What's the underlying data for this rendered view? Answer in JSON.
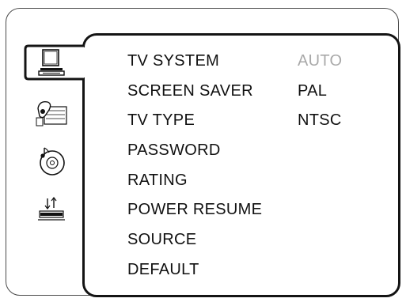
{
  "sidebar": {
    "icons": [
      {
        "name": "tv-monitor-icon",
        "active": true
      },
      {
        "name": "speaker-doc-icon",
        "active": false
      },
      {
        "name": "disc-music-icon",
        "active": false
      },
      {
        "name": "transfer-icon",
        "active": false
      }
    ]
  },
  "menu": {
    "items": [
      {
        "label": "TV  SYSTEM",
        "selected": true
      },
      {
        "label": "SCREEN SAVER",
        "selected": false
      },
      {
        "label": "TV TYPE",
        "selected": false
      },
      {
        "label": "PASSWORD",
        "selected": false
      },
      {
        "label": "RATING",
        "selected": false
      },
      {
        "label": "POWER RESUME",
        "selected": false
      },
      {
        "label": "SOURCE",
        "selected": false
      },
      {
        "label": "DEFAULT",
        "selected": false
      }
    ]
  },
  "options": {
    "items": [
      {
        "label": "AUTO",
        "highlighted": true
      },
      {
        "label": "PAL",
        "highlighted": false
      },
      {
        "label": "NTSC",
        "highlighted": false
      }
    ]
  },
  "colors": {
    "border": "#141414",
    "highlight_text": "#a9a9a9",
    "text": "#111111"
  }
}
